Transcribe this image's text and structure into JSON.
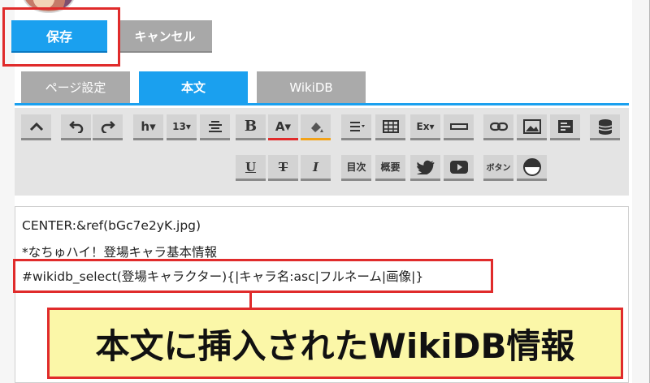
{
  "actions": {
    "save_label": "保存",
    "cancel_label": "キャンセル"
  },
  "tabs": [
    {
      "label": "ページ設定"
    },
    {
      "label": "本文"
    },
    {
      "label": "WikiDB"
    }
  ],
  "toolbar": {
    "row1": [
      {
        "name": "collapse-icon"
      },
      {
        "name": "undo-icon"
      },
      {
        "name": "redo-icon"
      },
      {
        "name": "heading-icon",
        "label": "h▾"
      },
      {
        "name": "font-size-icon",
        "label": "13▾"
      },
      {
        "name": "align-icon"
      },
      {
        "name": "bold-icon",
        "label": "B"
      },
      {
        "name": "text-color-icon",
        "label": "A▾"
      },
      {
        "name": "highlight-icon"
      },
      {
        "name": "list-icon"
      },
      {
        "name": "table-icon"
      },
      {
        "name": "extension-icon",
        "label": "Ex▾"
      },
      {
        "name": "horizontal-rule-icon"
      },
      {
        "name": "link-icon"
      },
      {
        "name": "image-icon"
      },
      {
        "name": "layout-icon"
      },
      {
        "name": "database-icon"
      }
    ],
    "row2": [
      {
        "name": "underline-icon",
        "label": "U"
      },
      {
        "name": "strikethrough-icon",
        "label": "T"
      },
      {
        "name": "italic-icon",
        "label": "I"
      },
      {
        "name": "toc-button",
        "label": "目次"
      },
      {
        "name": "outline-button",
        "label": "概要"
      },
      {
        "name": "twitter-icon"
      },
      {
        "name": "youtube-icon"
      },
      {
        "name": "button-button",
        "label": "ボタン"
      },
      {
        "name": "half-circle-icon"
      }
    ]
  },
  "editor": {
    "lines": [
      "CENTER:&ref(bGc7e2yK.jpg)",
      "*なちゅハイ！登場キャラ基本情報",
      "#wikidb_select(登場キャラクター){|キャラ名:asc|フルネーム|画像|}"
    ]
  },
  "callout": {
    "text": "本文に挿入されたWikiDB情報"
  },
  "colors": {
    "accent": "#1aa0ef",
    "annotation": "#e02b2b",
    "callout_bg": "#fbf7a8"
  }
}
